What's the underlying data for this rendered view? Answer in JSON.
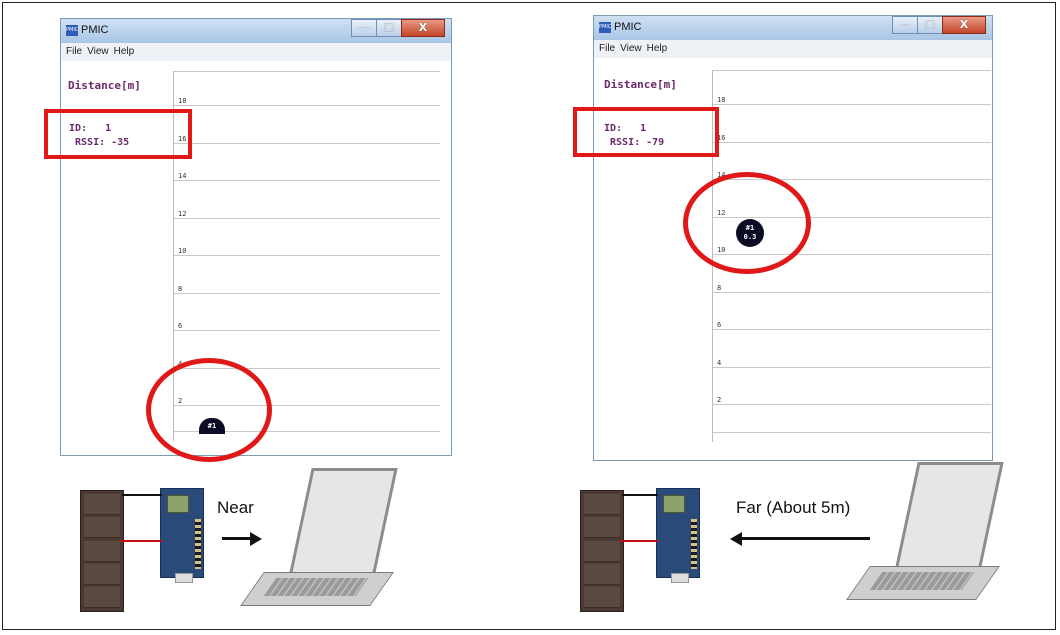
{
  "caption_top": "                 (     )",
  "left_window": {
    "title": "PMIC",
    "app_icon": "PMIC",
    "menu": [
      "File",
      "View",
      "Help"
    ],
    "distance_label": "Distance[m]",
    "id_line": "ID:   1",
    "rssi_line": " RSSI: -35",
    "ticks": [
      "18",
      "16",
      "14",
      "12",
      "10",
      "8",
      "6",
      "4",
      "2"
    ],
    "marker": {
      "label": "#1",
      "distance": 0
    }
  },
  "right_window": {
    "title": "PMIC",
    "app_icon": "PMIC",
    "menu": [
      "File",
      "View",
      "Help"
    ],
    "distance_label": "Distance[m]",
    "id_line": "ID:   1",
    "rssi_line": " RSSI: -79",
    "ticks": [
      "18",
      "16",
      "14",
      "12",
      "10",
      "8",
      "6",
      "4",
      "2"
    ],
    "marker": {
      "label": "#1",
      "value": "0.3"
    }
  },
  "window_controls": {
    "minimize": "—",
    "maximize": "□",
    "close": "X"
  },
  "captions": {
    "near": "Near",
    "far": "Far (About 5m)"
  },
  "colors": {
    "highlight": "#e01818",
    "text_purple": "#6b2a6b",
    "marker": "#0c0c24"
  }
}
